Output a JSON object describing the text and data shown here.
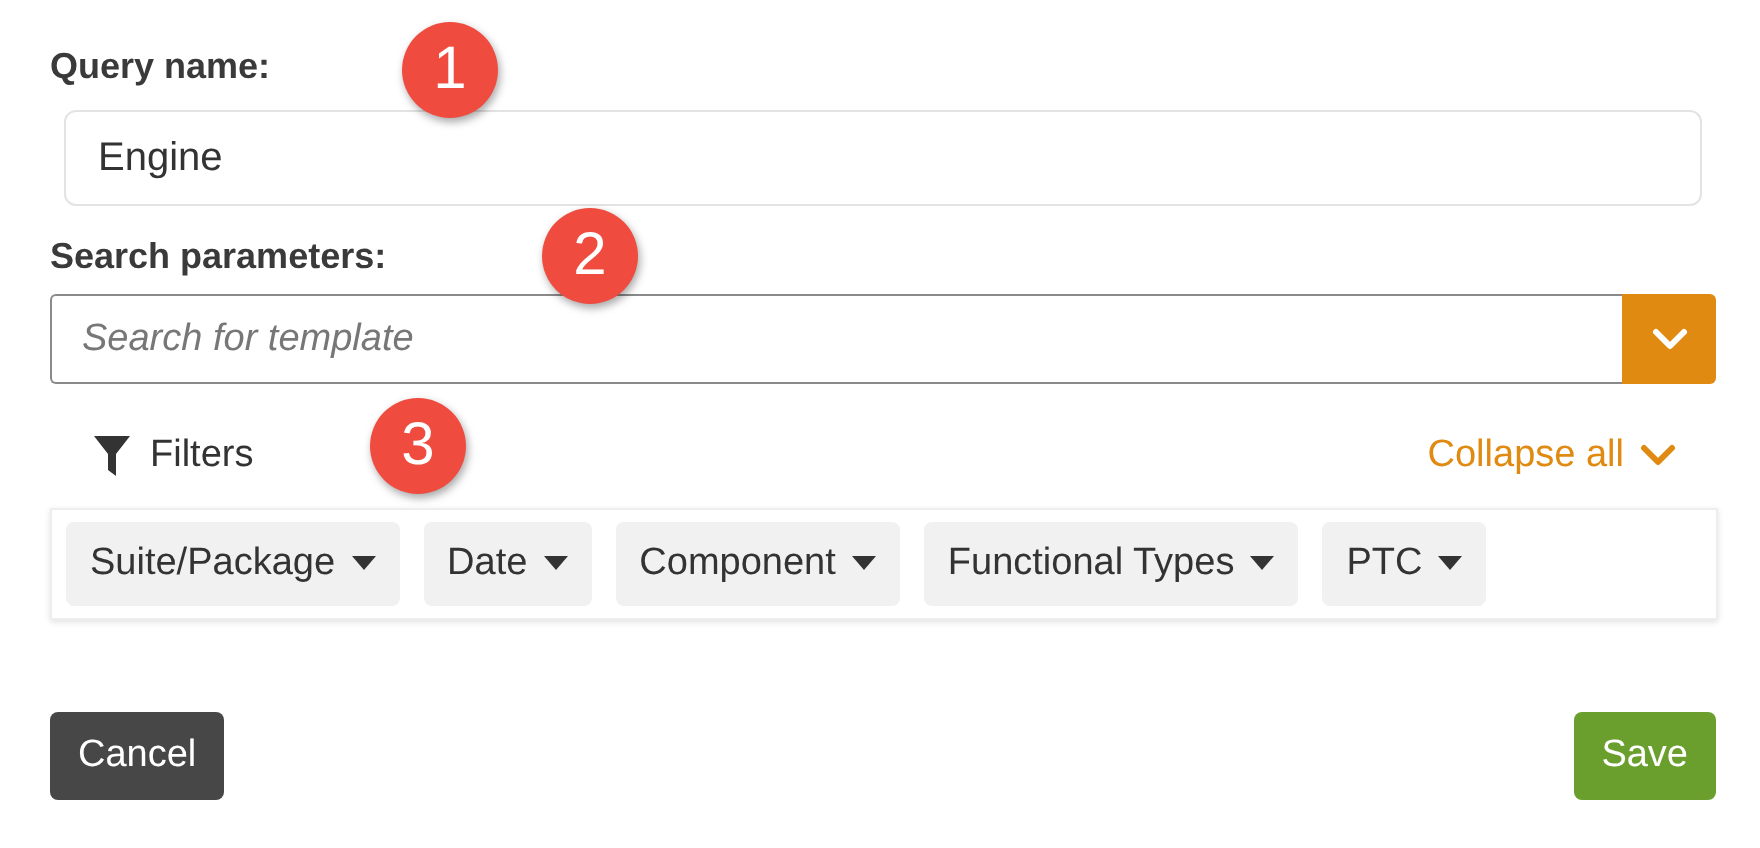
{
  "query_name": {
    "label": "Query name:",
    "value": "Engine"
  },
  "search_parameters": {
    "label": "Search parameters:",
    "placeholder": "Search for template"
  },
  "filters": {
    "label": "Filters",
    "collapse": "Collapse all",
    "chips": [
      "Suite/Package",
      "Date",
      "Component",
      "Functional Types",
      "PTC"
    ]
  },
  "callouts": [
    "1",
    "2",
    "3"
  ],
  "buttons": {
    "cancel": "Cancel",
    "save": "Save"
  }
}
